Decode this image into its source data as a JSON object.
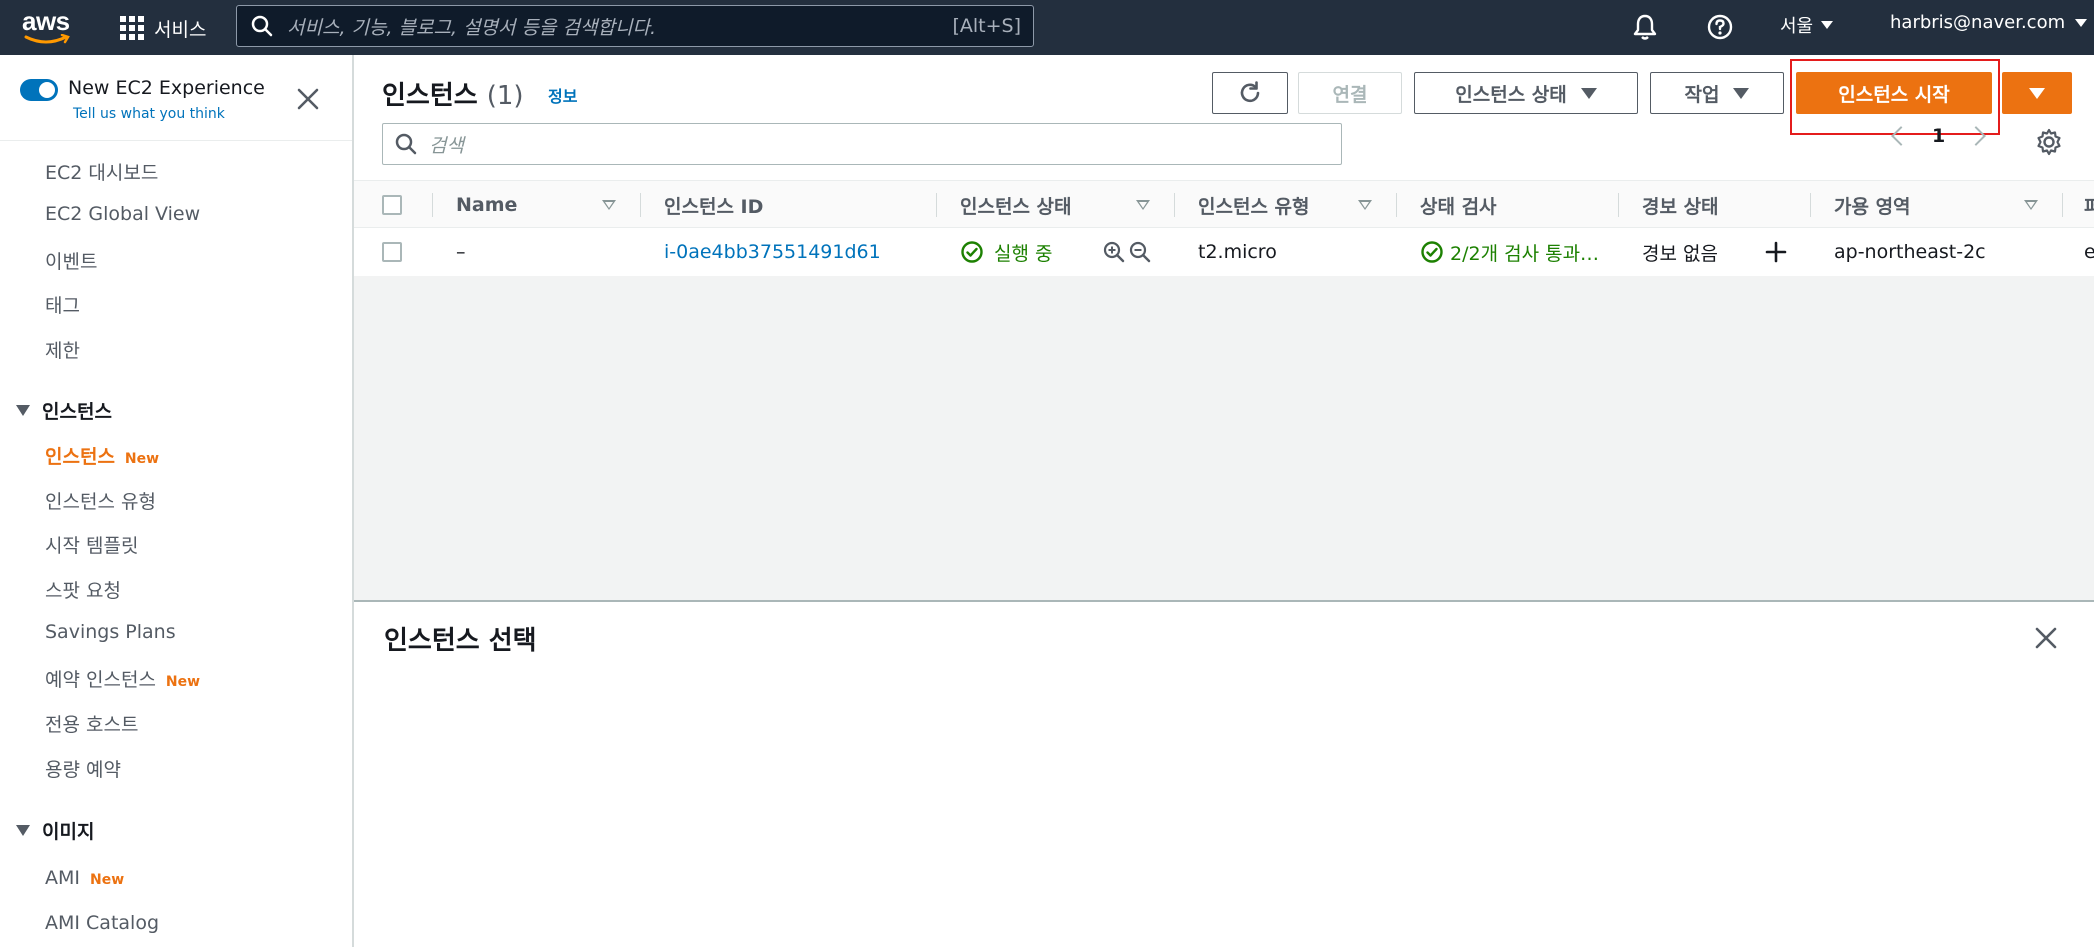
{
  "topnav": {
    "logo_text": "aws",
    "services_label": "서비스",
    "search_placeholder": "서비스, 기능, 블로그, 설명서 등을 검색합니다.",
    "search_shortcut": "[Alt+S]",
    "region_label": "서울",
    "account_label": "harbris@naver.com"
  },
  "sidebar": {
    "experience_title": "New EC2 Experience",
    "experience_link": "Tell us what you think",
    "top_items": [
      "EC2 대시보드",
      "EC2 Global View",
      "이벤트",
      "태그",
      "제한"
    ],
    "section_instances": {
      "heading": "인스턴스",
      "items": [
        {
          "label": "인스턴스",
          "badge": "New"
        },
        {
          "label": "인스턴스 유형",
          "badge": ""
        },
        {
          "label": "시작 템플릿",
          "badge": ""
        },
        {
          "label": "스팟 요청",
          "badge": ""
        },
        {
          "label": "Savings Plans",
          "badge": ""
        },
        {
          "label": "예약 인스턴스",
          "badge": "New"
        },
        {
          "label": "전용 호스트",
          "badge": ""
        },
        {
          "label": "용량 예약",
          "badge": ""
        }
      ]
    },
    "section_images": {
      "heading": "이미지",
      "items": [
        {
          "label": "AMI",
          "badge": "New"
        },
        {
          "label": "AMI Catalog",
          "badge": ""
        }
      ]
    }
  },
  "main": {
    "title": "인스턴스",
    "count": "(1)",
    "info_link": "정보",
    "buttons": {
      "connect": "연결",
      "instance_state": "인스턴스 상태",
      "actions": "작업",
      "launch": "인스턴스 시작"
    },
    "filter_placeholder": "검색",
    "page_number": "1",
    "columns": [
      "Name",
      "인스턴스 ID",
      "인스턴스 상태",
      "인스턴스 유형",
      "상태 검사",
      "경보 상태",
      "가용 영역",
      "퍼"
    ],
    "row": {
      "name": "–",
      "instance_id": "i-0ae4bb37551491d61",
      "state": "실행 중",
      "type": "t2.micro",
      "status_check": "2/2개 검사 통과…",
      "alarm": "경보 없음",
      "az": "ap-northeast-2c",
      "extra": "e"
    }
  },
  "detail": {
    "title": "인스턴스 선택"
  },
  "colors": {
    "nav_bg": "#232f3e",
    "accent_orange": "#ec7211",
    "link_blue": "#0073bb",
    "success_green": "#1d8102",
    "highlight_red": "#e41c1c"
  }
}
